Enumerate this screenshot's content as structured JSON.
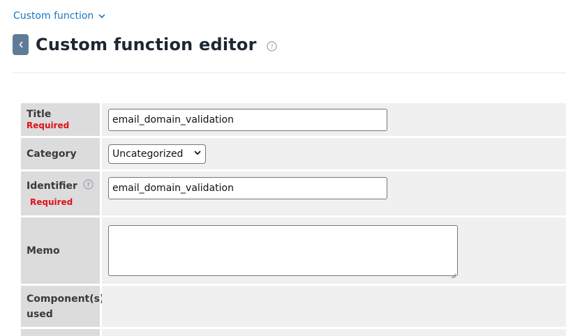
{
  "breadcrumb": {
    "label": "Custom function",
    "icon": "chevron-down-icon"
  },
  "header": {
    "title": "Custom function editor",
    "back_icon": "chevron-left-icon",
    "help_icon": "question-circle-icon"
  },
  "colors": {
    "link": "#1a78c2",
    "back_button": "#607b98",
    "required": "#e0101a",
    "label_bg": "#dcdcdc",
    "value_bg": "#f0f0f0"
  },
  "form": {
    "required_text": "Required",
    "title": {
      "label": "Title",
      "value": "email_domain_validation"
    },
    "category": {
      "label": "Category",
      "selected": "Uncategorized"
    },
    "identifier": {
      "label": "Identifier",
      "value": "email_domain_validation"
    },
    "memo": {
      "label": "Memo",
      "value": ""
    },
    "components": {
      "label": "Component(s) used"
    }
  }
}
